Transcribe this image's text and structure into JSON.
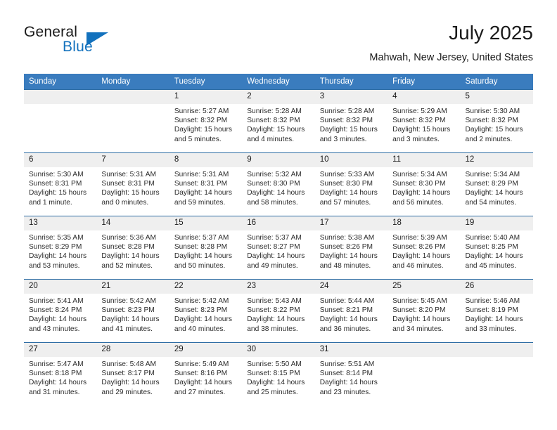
{
  "brand": {
    "name_top": "General",
    "name_bottom": "Blue",
    "accent_color": "#1271bd",
    "logo_icon": "triangle-flag-icon"
  },
  "header": {
    "title": "July 2025",
    "subtitle": "Mahwah, New Jersey, United States"
  },
  "colors": {
    "header_band": "#3a7cbe",
    "row_divider": "#2e6da4",
    "daynum_band": "#efefef",
    "text": "#1a1a1a"
  },
  "calendar": {
    "weekday_headers": [
      "Sunday",
      "Monday",
      "Tuesday",
      "Wednesday",
      "Thursday",
      "Friday",
      "Saturday"
    ],
    "labels": {
      "sunrise": "Sunrise:",
      "sunset": "Sunset:",
      "daylight": "Daylight:"
    },
    "weeks": [
      [
        {
          "day": "",
          "sunrise": "",
          "sunset": "",
          "daylight_1": "",
          "daylight_2": ""
        },
        {
          "day": "",
          "sunrise": "",
          "sunset": "",
          "daylight_1": "",
          "daylight_2": ""
        },
        {
          "day": "1",
          "sunrise": "Sunrise: 5:27 AM",
          "sunset": "Sunset: 8:32 PM",
          "daylight_1": "Daylight: 15 hours",
          "daylight_2": "and 5 minutes."
        },
        {
          "day": "2",
          "sunrise": "Sunrise: 5:28 AM",
          "sunset": "Sunset: 8:32 PM",
          "daylight_1": "Daylight: 15 hours",
          "daylight_2": "and 4 minutes."
        },
        {
          "day": "3",
          "sunrise": "Sunrise: 5:28 AM",
          "sunset": "Sunset: 8:32 PM",
          "daylight_1": "Daylight: 15 hours",
          "daylight_2": "and 3 minutes."
        },
        {
          "day": "4",
          "sunrise": "Sunrise: 5:29 AM",
          "sunset": "Sunset: 8:32 PM",
          "daylight_1": "Daylight: 15 hours",
          "daylight_2": "and 3 minutes."
        },
        {
          "day": "5",
          "sunrise": "Sunrise: 5:30 AM",
          "sunset": "Sunset: 8:32 PM",
          "daylight_1": "Daylight: 15 hours",
          "daylight_2": "and 2 minutes."
        }
      ],
      [
        {
          "day": "6",
          "sunrise": "Sunrise: 5:30 AM",
          "sunset": "Sunset: 8:31 PM",
          "daylight_1": "Daylight: 15 hours",
          "daylight_2": "and 1 minute."
        },
        {
          "day": "7",
          "sunrise": "Sunrise: 5:31 AM",
          "sunset": "Sunset: 8:31 PM",
          "daylight_1": "Daylight: 15 hours",
          "daylight_2": "and 0 minutes."
        },
        {
          "day": "8",
          "sunrise": "Sunrise: 5:31 AM",
          "sunset": "Sunset: 8:31 PM",
          "daylight_1": "Daylight: 14 hours",
          "daylight_2": "and 59 minutes."
        },
        {
          "day": "9",
          "sunrise": "Sunrise: 5:32 AM",
          "sunset": "Sunset: 8:30 PM",
          "daylight_1": "Daylight: 14 hours",
          "daylight_2": "and 58 minutes."
        },
        {
          "day": "10",
          "sunrise": "Sunrise: 5:33 AM",
          "sunset": "Sunset: 8:30 PM",
          "daylight_1": "Daylight: 14 hours",
          "daylight_2": "and 57 minutes."
        },
        {
          "day": "11",
          "sunrise": "Sunrise: 5:34 AM",
          "sunset": "Sunset: 8:30 PM",
          "daylight_1": "Daylight: 14 hours",
          "daylight_2": "and 56 minutes."
        },
        {
          "day": "12",
          "sunrise": "Sunrise: 5:34 AM",
          "sunset": "Sunset: 8:29 PM",
          "daylight_1": "Daylight: 14 hours",
          "daylight_2": "and 54 minutes."
        }
      ],
      [
        {
          "day": "13",
          "sunrise": "Sunrise: 5:35 AM",
          "sunset": "Sunset: 8:29 PM",
          "daylight_1": "Daylight: 14 hours",
          "daylight_2": "and 53 minutes."
        },
        {
          "day": "14",
          "sunrise": "Sunrise: 5:36 AM",
          "sunset": "Sunset: 8:28 PM",
          "daylight_1": "Daylight: 14 hours",
          "daylight_2": "and 52 minutes."
        },
        {
          "day": "15",
          "sunrise": "Sunrise: 5:37 AM",
          "sunset": "Sunset: 8:28 PM",
          "daylight_1": "Daylight: 14 hours",
          "daylight_2": "and 50 minutes."
        },
        {
          "day": "16",
          "sunrise": "Sunrise: 5:37 AM",
          "sunset": "Sunset: 8:27 PM",
          "daylight_1": "Daylight: 14 hours",
          "daylight_2": "and 49 minutes."
        },
        {
          "day": "17",
          "sunrise": "Sunrise: 5:38 AM",
          "sunset": "Sunset: 8:26 PM",
          "daylight_1": "Daylight: 14 hours",
          "daylight_2": "and 48 minutes."
        },
        {
          "day": "18",
          "sunrise": "Sunrise: 5:39 AM",
          "sunset": "Sunset: 8:26 PM",
          "daylight_1": "Daylight: 14 hours",
          "daylight_2": "and 46 minutes."
        },
        {
          "day": "19",
          "sunrise": "Sunrise: 5:40 AM",
          "sunset": "Sunset: 8:25 PM",
          "daylight_1": "Daylight: 14 hours",
          "daylight_2": "and 45 minutes."
        }
      ],
      [
        {
          "day": "20",
          "sunrise": "Sunrise: 5:41 AM",
          "sunset": "Sunset: 8:24 PM",
          "daylight_1": "Daylight: 14 hours",
          "daylight_2": "and 43 minutes."
        },
        {
          "day": "21",
          "sunrise": "Sunrise: 5:42 AM",
          "sunset": "Sunset: 8:23 PM",
          "daylight_1": "Daylight: 14 hours",
          "daylight_2": "and 41 minutes."
        },
        {
          "day": "22",
          "sunrise": "Sunrise: 5:42 AM",
          "sunset": "Sunset: 8:23 PM",
          "daylight_1": "Daylight: 14 hours",
          "daylight_2": "and 40 minutes."
        },
        {
          "day": "23",
          "sunrise": "Sunrise: 5:43 AM",
          "sunset": "Sunset: 8:22 PM",
          "daylight_1": "Daylight: 14 hours",
          "daylight_2": "and 38 minutes."
        },
        {
          "day": "24",
          "sunrise": "Sunrise: 5:44 AM",
          "sunset": "Sunset: 8:21 PM",
          "daylight_1": "Daylight: 14 hours",
          "daylight_2": "and 36 minutes."
        },
        {
          "day": "25",
          "sunrise": "Sunrise: 5:45 AM",
          "sunset": "Sunset: 8:20 PM",
          "daylight_1": "Daylight: 14 hours",
          "daylight_2": "and 34 minutes."
        },
        {
          "day": "26",
          "sunrise": "Sunrise: 5:46 AM",
          "sunset": "Sunset: 8:19 PM",
          "daylight_1": "Daylight: 14 hours",
          "daylight_2": "and 33 minutes."
        }
      ],
      [
        {
          "day": "27",
          "sunrise": "Sunrise: 5:47 AM",
          "sunset": "Sunset: 8:18 PM",
          "daylight_1": "Daylight: 14 hours",
          "daylight_2": "and 31 minutes."
        },
        {
          "day": "28",
          "sunrise": "Sunrise: 5:48 AM",
          "sunset": "Sunset: 8:17 PM",
          "daylight_1": "Daylight: 14 hours",
          "daylight_2": "and 29 minutes."
        },
        {
          "day": "29",
          "sunrise": "Sunrise: 5:49 AM",
          "sunset": "Sunset: 8:16 PM",
          "daylight_1": "Daylight: 14 hours",
          "daylight_2": "and 27 minutes."
        },
        {
          "day": "30",
          "sunrise": "Sunrise: 5:50 AM",
          "sunset": "Sunset: 8:15 PM",
          "daylight_1": "Daylight: 14 hours",
          "daylight_2": "and 25 minutes."
        },
        {
          "day": "31",
          "sunrise": "Sunrise: 5:51 AM",
          "sunset": "Sunset: 8:14 PM",
          "daylight_1": "Daylight: 14 hours",
          "daylight_2": "and 23 minutes."
        },
        {
          "day": "",
          "sunrise": "",
          "sunset": "",
          "daylight_1": "",
          "daylight_2": ""
        },
        {
          "day": "",
          "sunrise": "",
          "sunset": "",
          "daylight_1": "",
          "daylight_2": ""
        }
      ]
    ]
  }
}
